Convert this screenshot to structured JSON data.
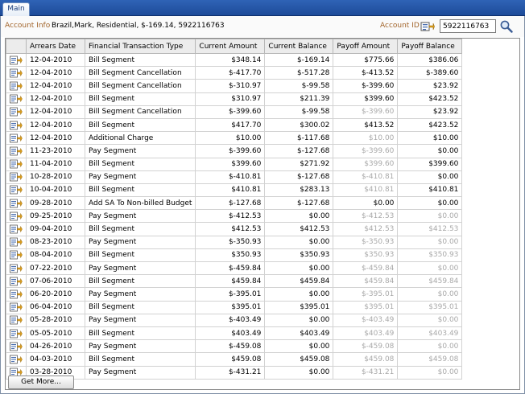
{
  "tab_label": "Main",
  "info": {
    "label": "Account Info",
    "text": "Brazil,Mark, Residential, $-169.14, 5922116763",
    "account_id_label": "Account ID",
    "account_id_value": "5922116763"
  },
  "columns": [
    "Arrears Date",
    "Financial Transaction Type",
    "Current Amount",
    "Current Balance",
    "Payoff Amount",
    "Payoff Balance"
  ],
  "rows": [
    {
      "date": "12-04-2010",
      "type": "Bill Segment",
      "cur_amt": "$348.14",
      "cur_bal": "$-169.14",
      "pay_amt": "$775.66",
      "pay_bal": "$386.06",
      "dim_pay_amt": false,
      "dim_pay_bal": false
    },
    {
      "date": "12-04-2010",
      "type": "Bill Segment Cancellation",
      "cur_amt": "$-417.70",
      "cur_bal": "$-517.28",
      "pay_amt": "$-413.52",
      "pay_bal": "$-389.60",
      "dim_pay_amt": false,
      "dim_pay_bal": false
    },
    {
      "date": "12-04-2010",
      "type": "Bill Segment Cancellation",
      "cur_amt": "$-310.97",
      "cur_bal": "$-99.58",
      "pay_amt": "$-399.60",
      "pay_bal": "$23.92",
      "dim_pay_amt": false,
      "dim_pay_bal": false
    },
    {
      "date": "12-04-2010",
      "type": "Bill Segment",
      "cur_amt": "$310.97",
      "cur_bal": "$211.39",
      "pay_amt": "$399.60",
      "pay_bal": "$423.52",
      "dim_pay_amt": false,
      "dim_pay_bal": false
    },
    {
      "date": "12-04-2010",
      "type": "Bill Segment Cancellation",
      "cur_amt": "$-399.60",
      "cur_bal": "$-99.58",
      "pay_amt": "$-399.60",
      "pay_bal": "$23.92",
      "dim_pay_amt": true,
      "dim_pay_bal": false
    },
    {
      "date": "12-04-2010",
      "type": "Bill Segment",
      "cur_amt": "$417.70",
      "cur_bal": "$300.02",
      "pay_amt": "$413.52",
      "pay_bal": "$423.52",
      "dim_pay_amt": false,
      "dim_pay_bal": false
    },
    {
      "date": "12-04-2010",
      "type": "Additional Charge",
      "cur_amt": "$10.00",
      "cur_bal": "$-117.68",
      "pay_amt": "$10.00",
      "pay_bal": "$10.00",
      "dim_pay_amt": true,
      "dim_pay_bal": false
    },
    {
      "date": "11-23-2010",
      "type": "Pay Segment",
      "cur_amt": "$-399.60",
      "cur_bal": "$-127.68",
      "pay_amt": "$-399.60",
      "pay_bal": "$0.00",
      "dim_pay_amt": true,
      "dim_pay_bal": false
    },
    {
      "date": "11-04-2010",
      "type": "Bill Segment",
      "cur_amt": "$399.60",
      "cur_bal": "$271.92",
      "pay_amt": "$399.60",
      "pay_bal": "$399.60",
      "dim_pay_amt": true,
      "dim_pay_bal": false
    },
    {
      "date": "10-28-2010",
      "type": "Pay Segment",
      "cur_amt": "$-410.81",
      "cur_bal": "$-127.68",
      "pay_amt": "$-410.81",
      "pay_bal": "$0.00",
      "dim_pay_amt": true,
      "dim_pay_bal": false
    },
    {
      "date": "10-04-2010",
      "type": "Bill Segment",
      "cur_amt": "$410.81",
      "cur_bal": "$283.13",
      "pay_amt": "$410.81",
      "pay_bal": "$410.81",
      "dim_pay_amt": true,
      "dim_pay_bal": false
    },
    {
      "date": "09-28-2010",
      "type": "Add SA To Non-billed Budget",
      "cur_amt": "$-127.68",
      "cur_bal": "$-127.68",
      "pay_amt": "$0.00",
      "pay_bal": "$0.00",
      "dim_pay_amt": false,
      "dim_pay_bal": false
    },
    {
      "date": "09-25-2010",
      "type": "Pay Segment",
      "cur_amt": "$-412.53",
      "cur_bal": "$0.00",
      "pay_amt": "$-412.53",
      "pay_bal": "$0.00",
      "dim_pay_amt": true,
      "dim_pay_bal": true
    },
    {
      "date": "09-04-2010",
      "type": "Bill Segment",
      "cur_amt": "$412.53",
      "cur_bal": "$412.53",
      "pay_amt": "$412.53",
      "pay_bal": "$412.53",
      "dim_pay_amt": true,
      "dim_pay_bal": true
    },
    {
      "date": "08-23-2010",
      "type": "Pay Segment",
      "cur_amt": "$-350.93",
      "cur_bal": "$0.00",
      "pay_amt": "$-350.93",
      "pay_bal": "$0.00",
      "dim_pay_amt": true,
      "dim_pay_bal": true
    },
    {
      "date": "08-04-2010",
      "type": "Bill Segment",
      "cur_amt": "$350.93",
      "cur_bal": "$350.93",
      "pay_amt": "$350.93",
      "pay_bal": "$350.93",
      "dim_pay_amt": true,
      "dim_pay_bal": true
    },
    {
      "date": "07-22-2010",
      "type": "Pay Segment",
      "cur_amt": "$-459.84",
      "cur_bal": "$0.00",
      "pay_amt": "$-459.84",
      "pay_bal": "$0.00",
      "dim_pay_amt": true,
      "dim_pay_bal": true
    },
    {
      "date": "07-06-2010",
      "type": "Bill Segment",
      "cur_amt": "$459.84",
      "cur_bal": "$459.84",
      "pay_amt": "$459.84",
      "pay_bal": "$459.84",
      "dim_pay_amt": true,
      "dim_pay_bal": true
    },
    {
      "date": "06-20-2010",
      "type": "Pay Segment",
      "cur_amt": "$-395.01",
      "cur_bal": "$0.00",
      "pay_amt": "$-395.01",
      "pay_bal": "$0.00",
      "dim_pay_amt": true,
      "dim_pay_bal": true
    },
    {
      "date": "06-04-2010",
      "type": "Bill Segment",
      "cur_amt": "$395.01",
      "cur_bal": "$395.01",
      "pay_amt": "$395.01",
      "pay_bal": "$395.01",
      "dim_pay_amt": true,
      "dim_pay_bal": true
    },
    {
      "date": "05-28-2010",
      "type": "Pay Segment",
      "cur_amt": "$-403.49",
      "cur_bal": "$0.00",
      "pay_amt": "$-403.49",
      "pay_bal": "$0.00",
      "dim_pay_amt": true,
      "dim_pay_bal": true
    },
    {
      "date": "05-05-2010",
      "type": "Bill Segment",
      "cur_amt": "$403.49",
      "cur_bal": "$403.49",
      "pay_amt": "$403.49",
      "pay_bal": "$403.49",
      "dim_pay_amt": true,
      "dim_pay_bal": true
    },
    {
      "date": "04-26-2010",
      "type": "Pay Segment",
      "cur_amt": "$-459.08",
      "cur_bal": "$0.00",
      "pay_amt": "$-459.08",
      "pay_bal": "$0.00",
      "dim_pay_amt": true,
      "dim_pay_bal": true
    },
    {
      "date": "04-03-2010",
      "type": "Bill Segment",
      "cur_amt": "$459.08",
      "cur_bal": "$459.08",
      "pay_amt": "$459.08",
      "pay_bal": "$459.08",
      "dim_pay_amt": true,
      "dim_pay_bal": true
    },
    {
      "date": "03-28-2010",
      "type": "Pay Segment",
      "cur_amt": "$-431.21",
      "cur_bal": "$0.00",
      "pay_amt": "$-431.21",
      "pay_bal": "$0.00",
      "dim_pay_amt": true,
      "dim_pay_bal": true
    }
  ],
  "get_more_label": "Get More...",
  "icons": {
    "row_icon": "context-menu-icon",
    "account_icon": "context-menu-icon",
    "search_icon": "search-icon"
  },
  "colors": {
    "header_blue": "#2f63b6",
    "label_brown": "#a2642a",
    "dim_text": "#a9a9a9"
  }
}
